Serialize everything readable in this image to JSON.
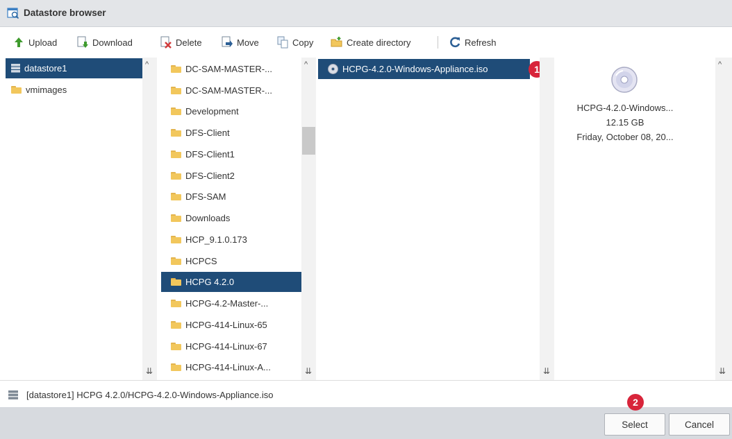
{
  "window": {
    "title": "Datastore browser"
  },
  "toolbar": {
    "upload_label": "Upload",
    "download_label": "Download",
    "delete_label": "Delete",
    "move_label": "Move",
    "copy_label": "Copy",
    "create_directory_label": "Create directory",
    "refresh_label": "Refresh"
  },
  "datastores": [
    {
      "label": "datastore1",
      "icon": "datastore-icon",
      "selected": true
    },
    {
      "label": "vmimages",
      "icon": "folder-icon",
      "selected": false
    }
  ],
  "folders": [
    {
      "label": "DC-SAM-MASTER-..."
    },
    {
      "label": "DC-SAM-MASTER-..."
    },
    {
      "label": "Development"
    },
    {
      "label": "DFS-Client"
    },
    {
      "label": "DFS-Client1"
    },
    {
      "label": "DFS-Client2"
    },
    {
      "label": "DFS-SAM"
    },
    {
      "label": "Downloads"
    },
    {
      "label": "HCP_9.1.0.173"
    },
    {
      "label": "HCPCS"
    },
    {
      "label": "HCPG 4.2.0",
      "selected": true
    },
    {
      "label": "HCPG-4.2-Master-..."
    },
    {
      "label": "HCPG-414-Linux-65"
    },
    {
      "label": "HCPG-414-Linux-67"
    },
    {
      "label": "HCPG-414-Linux-A..."
    }
  ],
  "files": [
    {
      "label": "HCPG-4.2.0-Windows-Appliance.iso",
      "icon": "disc-icon",
      "selected": true
    }
  ],
  "preview": {
    "icon": "disc-icon",
    "name": "HCPG-4.2.0-Windows...",
    "size": "12.15 GB",
    "date": "Friday, October 08, 20..."
  },
  "path": {
    "text": "[datastore1] HCPG 4.2.0/HCPG-4.2.0-Windows-Appliance.iso"
  },
  "badges": {
    "one": "1",
    "two": "2"
  },
  "footer": {
    "select_label": "Select",
    "cancel_label": "Cancel"
  },
  "colors": {
    "selection": "#1f4c78",
    "badge": "#d8253b",
    "titlebar": "#e3e5e8",
    "footer": "#d7dadf"
  }
}
